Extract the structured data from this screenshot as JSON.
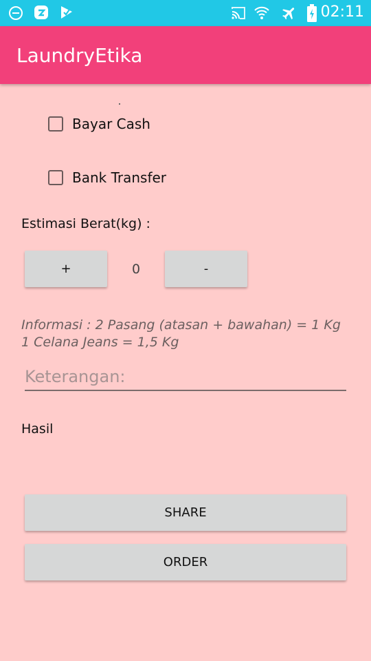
{
  "status_bar": {
    "time": "02:11",
    "left_icons": [
      "do-not-disturb-icon",
      "app-notification-icon",
      "download-check-icon"
    ],
    "right_icons": [
      "cast-icon",
      "wifi-icon",
      "airplane-mode-icon",
      "battery-charging-icon"
    ]
  },
  "app_bar": {
    "title": "LaundryEtika",
    "color": "#f2407a"
  },
  "payment": {
    "options": [
      {
        "label": "Bayar Cash",
        "checked": false
      },
      {
        "label": "Bank Transfer",
        "checked": false
      }
    ]
  },
  "weight": {
    "label": "Estimasi Berat(kg) :",
    "plus_label": "+",
    "minus_label": "-",
    "value": "0"
  },
  "info": {
    "line1": "Informasi : 2 Pasang (atasan + bawahan) = 1 Kg",
    "line2": "1 Celana Jeans = 1,5 Kg"
  },
  "notes": {
    "value": "",
    "placeholder": "Keterangan:"
  },
  "result": {
    "label": "Hasil"
  },
  "actions": {
    "share_label": "SHARE",
    "order_label": "ORDER"
  },
  "colors": {
    "status_bar": "#21c8e6",
    "background": "#ffcccb",
    "button": "#d6d7d7"
  }
}
